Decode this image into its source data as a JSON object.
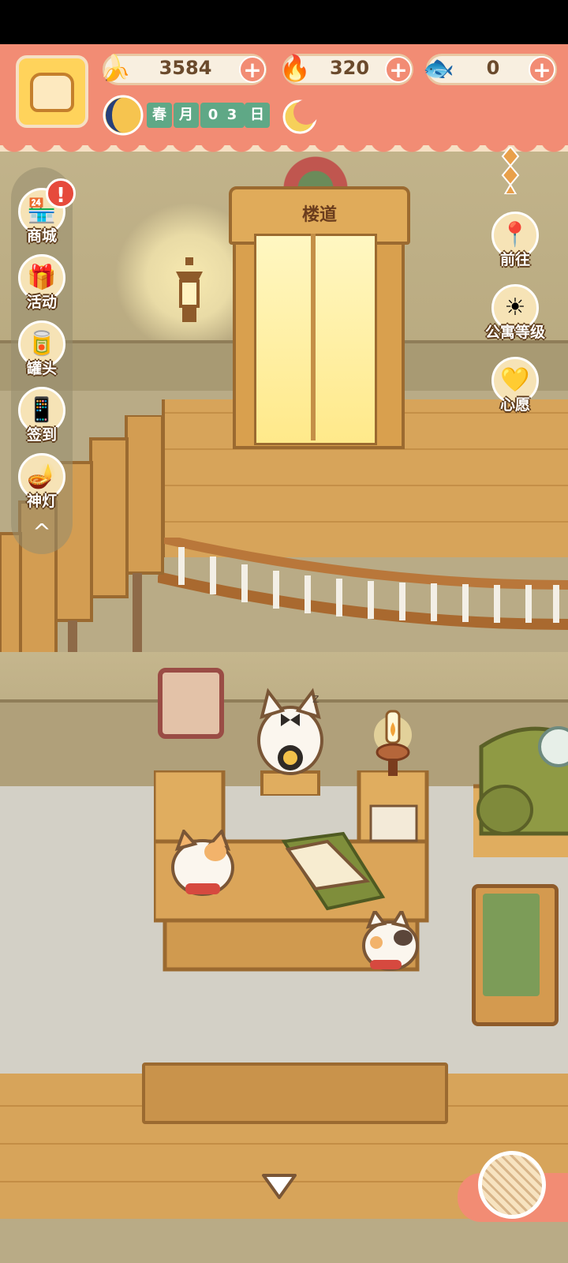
{
  "top_bar": {
    "resources": [
      {
        "name": "banana",
        "icon": "banana-icon",
        "value": "3584"
      },
      {
        "name": "flame",
        "icon": "blue-flame-icon",
        "value": "320"
      },
      {
        "name": "fish",
        "icon": "fish-icon",
        "value": "0"
      }
    ],
    "date": {
      "season": "春",
      "month_label": "月",
      "day_digits": [
        "0",
        "3"
      ],
      "day_label": "日"
    }
  },
  "scene": {
    "door_label": "楼道"
  },
  "left_menu": {
    "items": [
      {
        "label": "商城",
        "icon": "shop-icon",
        "badge": "!"
      },
      {
        "label": "活动",
        "icon": "gift-icon"
      },
      {
        "label": "罐头",
        "icon": "can-icon"
      },
      {
        "label": "签到",
        "icon": "checkin-icon"
      },
      {
        "label": "神灯",
        "icon": "magic-lamp-icon"
      }
    ],
    "collapse": "^"
  },
  "right_menu": {
    "items": [
      {
        "label": "前往",
        "icon": "map-pin-icon"
      },
      {
        "label": "公寓等级",
        "icon": "sun-badge-icon"
      },
      {
        "label": "心愿",
        "icon": "heart-book-icon"
      }
    ]
  },
  "colors": {
    "accent": "#f28c74",
    "pill_bg": "#f8efe0",
    "text_dark": "#6a4a2c",
    "date_green": "#5fa886"
  }
}
